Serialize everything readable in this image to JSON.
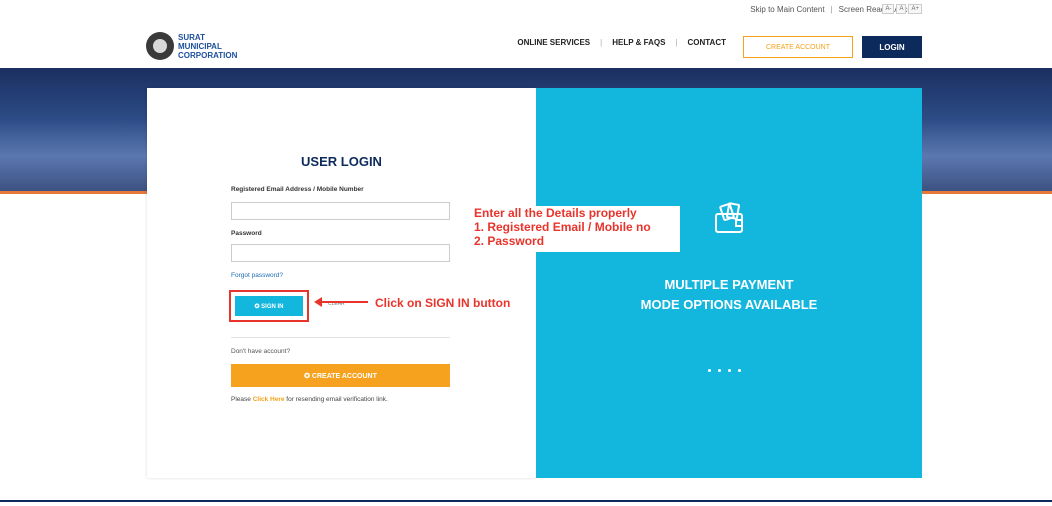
{
  "topbar": {
    "skip_link": "Skip to Main Content",
    "screen_reader": "Screen Reader Access",
    "font_small": "A-",
    "font_normal": "A",
    "font_large": "A+"
  },
  "header": {
    "logo_line1": "SURAT",
    "logo_line2": "MUNICIPAL",
    "logo_line3": "CORPORATION",
    "nav": [
      "ONLINE SERVICES",
      "HELP & FAQS",
      "CONTACT"
    ],
    "create_account": "CREATE ACCOUNT",
    "login": "LOGIN"
  },
  "login": {
    "title": "USER LOGIN",
    "email_label": "Registered Email Address / Mobile Number",
    "email_value": "",
    "password_label": "Password",
    "password_value": "",
    "forgot": "Forgot password?",
    "signin": "✪ SIGN IN",
    "clear": "CLEAR",
    "no_account": "Don't have account?",
    "create_account": "✪ CREATE ACCOUNT",
    "resend_prefix": "Please ",
    "resend_link": "Click Here",
    "resend_suffix": " for resending email verification link."
  },
  "annotations": {
    "details": "Enter all the Details properly\n1. Registered Email / Mobile no\n2. Password",
    "signin_hint": "Click on SIGN IN button"
  },
  "promo": {
    "line1": "MULTIPLE PAYMENT",
    "line2": "MODE OPTIONS AVAILABLE"
  },
  "colors": {
    "accent_cyan": "#13b6dd",
    "navy": "#0c2a5c",
    "orange": "#f7a21e",
    "annotation_red": "#e8342b"
  },
  "icons": [
    "wallet-icon",
    "logo-emblem-icon",
    "arrow-left-icon"
  ]
}
